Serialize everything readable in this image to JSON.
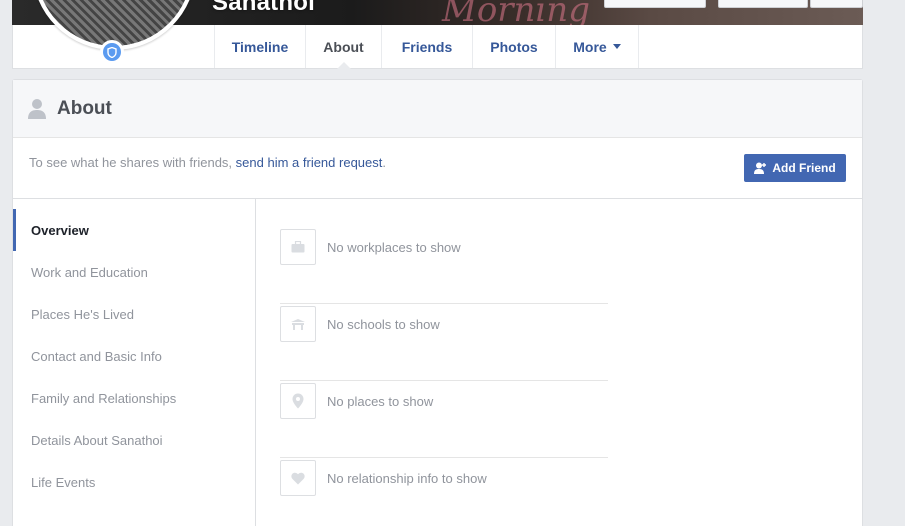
{
  "profile": {
    "name": "Sanathoi"
  },
  "tabs": [
    {
      "label": "Timeline"
    },
    {
      "label": "About"
    },
    {
      "label": "Friends"
    },
    {
      "label": "Photos"
    },
    {
      "label": "More"
    }
  ],
  "about": {
    "title": "About",
    "notice_text": "To see what he shares with friends, ",
    "notice_link": "send him a friend request",
    "notice_end": ".",
    "add_friend_label": "Add Friend"
  },
  "sidebar": {
    "items": [
      {
        "label": "Overview"
      },
      {
        "label": "Work and Education"
      },
      {
        "label": "Places He's Lived"
      },
      {
        "label": "Contact and Basic Info"
      },
      {
        "label": "Family and Relationships"
      },
      {
        "label": "Details About Sanathoi"
      },
      {
        "label": "Life Events"
      }
    ]
  },
  "overview": {
    "rows": [
      {
        "icon": "briefcase-icon",
        "text": "No workplaces to show"
      },
      {
        "icon": "school-icon",
        "text": "No schools to show"
      },
      {
        "icon": "location-pin-icon",
        "text": "No places to show"
      },
      {
        "icon": "heart-icon",
        "text": "No relationship info to show"
      }
    ]
  },
  "colors": {
    "link": "#365899",
    "button": "#4267b2",
    "muted": "#90949c"
  }
}
